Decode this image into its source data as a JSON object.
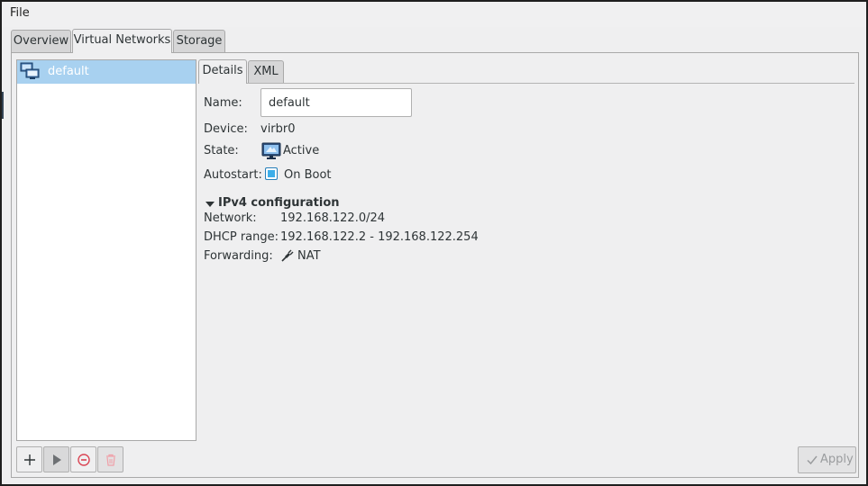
{
  "menubar": {
    "file": "File"
  },
  "tabs": {
    "overview": "Overview",
    "virtual_networks": "Virtual Networks",
    "storage": "Storage"
  },
  "networks": [
    {
      "name": "default",
      "icon": "network-icon",
      "selected": true
    }
  ],
  "detail_tabs": {
    "details": "Details",
    "xml": "XML"
  },
  "details": {
    "name_label": "Name:",
    "name_value": "default",
    "device_label": "Device:",
    "device_value": "virbr0",
    "state_label": "State:",
    "state_value": "Active",
    "autostart_label": "Autostart:",
    "autostart_value": "On Boot"
  },
  "ipv4": {
    "title": "IPv4 configuration",
    "network_label": "Network:",
    "network_value": "192.168.122.0/24",
    "dhcp_label": "DHCP range:",
    "dhcp_value": "192.168.122.2 - 192.168.122.254",
    "forwarding_label": "Forwarding:",
    "forwarding_value": "NAT"
  },
  "footer": {
    "apply_label": "Apply"
  },
  "colors": {
    "selection": "#a8d1f0",
    "accent": "#3daee9",
    "stop": "#da4453"
  }
}
